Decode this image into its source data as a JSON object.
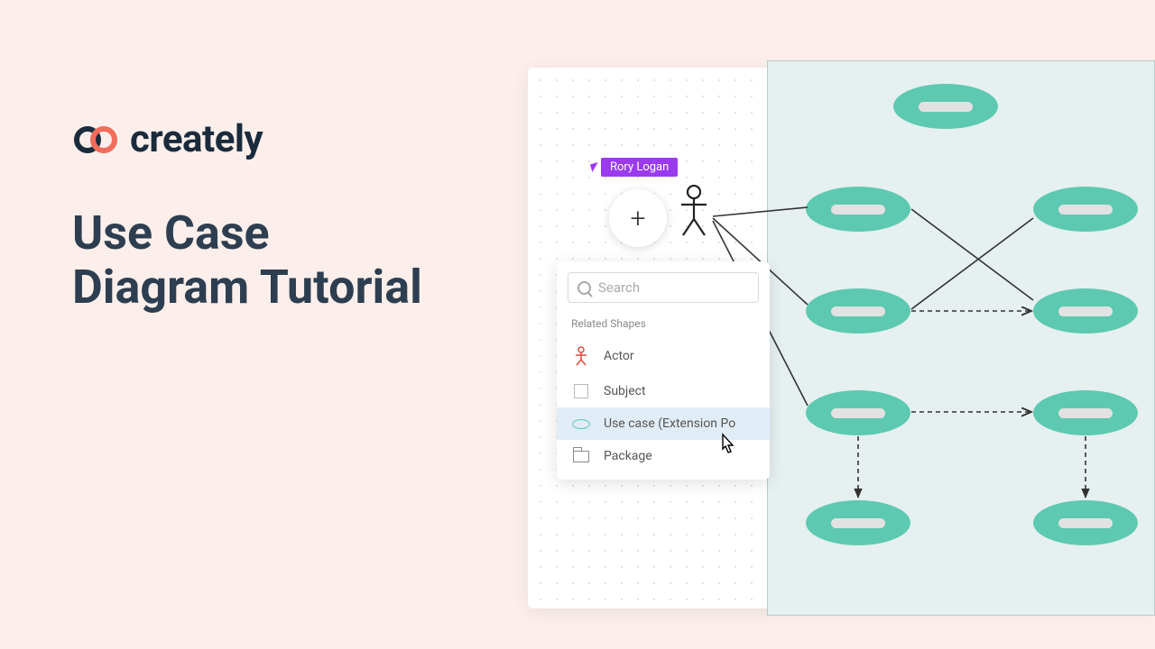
{
  "brand": "creately",
  "title_line1": "Use Case",
  "title_line2": "Diagram Tutorial",
  "collaborator": "Rory Logan",
  "search": {
    "placeholder": "Search"
  },
  "panel": {
    "heading": "Related Shapes",
    "items": [
      {
        "label": "Actor"
      },
      {
        "label": "Subject"
      },
      {
        "label": "Use case (Extension Po"
      },
      {
        "label": "Package"
      }
    ]
  },
  "colors": {
    "accent_teal": "#5dc9b0",
    "accent_purple": "#9b3aef",
    "bg_pink": "#fcefeb"
  }
}
